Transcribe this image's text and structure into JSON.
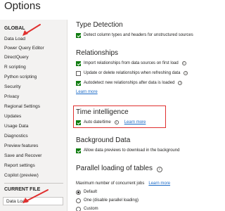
{
  "window": {
    "title": "Options"
  },
  "sidebar": {
    "global_header": "GLOBAL",
    "items": [
      {
        "label": "Data Load"
      },
      {
        "label": "Power Query Editor"
      },
      {
        "label": "DirectQuery"
      },
      {
        "label": "R scripting"
      },
      {
        "label": "Python scripting"
      },
      {
        "label": "Security"
      },
      {
        "label": "Privacy"
      },
      {
        "label": "Regional Settings"
      },
      {
        "label": "Updates"
      },
      {
        "label": "Usage Data"
      },
      {
        "label": "Diagnostics"
      },
      {
        "label": "Preview features"
      },
      {
        "label": "Save and Recover"
      },
      {
        "label": "Report settings"
      },
      {
        "label": "Copilot (preview)"
      }
    ],
    "current_file_header": "CURRENT FILE",
    "current_file_items": [
      {
        "label": "Data Load",
        "selected": true
      }
    ]
  },
  "main": {
    "type_detection": {
      "heading": "Type Detection",
      "option": {
        "label": "Detect column types and headers for unstructured sources",
        "checked": true
      }
    },
    "relationships": {
      "heading": "Relationships",
      "options": [
        {
          "label": "Import relationships from data sources on first load",
          "checked": true
        },
        {
          "label": "Update or delete relationships when refreshing data",
          "checked": false
        },
        {
          "label": "Autodetect new relationships after data is loaded",
          "checked": true
        }
      ],
      "learn_more": "Learn more"
    },
    "time_intelligence": {
      "heading": "Time intelligence",
      "option": {
        "label": "Auto date/time",
        "checked": true
      },
      "learn_more": "Learn more"
    },
    "background_data": {
      "heading": "Background Data",
      "option": {
        "label": "Allow data previews to download in the background",
        "checked": true
      }
    },
    "parallel_loading": {
      "heading": "Parallel loading of tables",
      "max_jobs_label": "Maximum number of concurrent jobs",
      "learn_more": "Learn more",
      "options": [
        {
          "label": "Default",
          "selected": true
        },
        {
          "label": "One (disable parallel loading)",
          "selected": false
        },
        {
          "label": "Custom",
          "selected": false
        }
      ]
    }
  },
  "colors": {
    "annotation": "#e0302f",
    "link": "#1a6ac7",
    "checkbox": "#107c10"
  },
  "icons": {
    "info": "info-icon",
    "arrow": "red-arrow-icon"
  }
}
